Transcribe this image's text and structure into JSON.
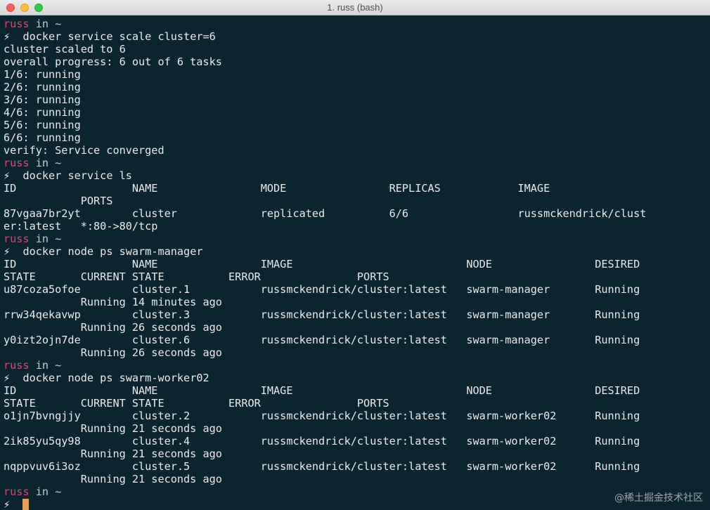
{
  "window": {
    "title": "1. russ (bash)"
  },
  "prompt": {
    "user": "russ",
    "rest": " in ~",
    "symbol": "⚡"
  },
  "lines": [
    {
      "kind": "prompt"
    },
    {
      "kind": "cmd",
      "text": "docker service scale cluster=6"
    },
    {
      "kind": "out",
      "text": "cluster scaled to 6"
    },
    {
      "kind": "out",
      "text": "overall progress: 6 out of 6 tasks"
    },
    {
      "kind": "out",
      "text": "1/6: running"
    },
    {
      "kind": "out",
      "text": "2/6: running"
    },
    {
      "kind": "out",
      "text": "3/6: running"
    },
    {
      "kind": "out",
      "text": "4/6: running"
    },
    {
      "kind": "out",
      "text": "5/6: running"
    },
    {
      "kind": "out",
      "text": "6/6: running"
    },
    {
      "kind": "out",
      "text": "verify: Service converged"
    },
    {
      "kind": "prompt"
    },
    {
      "kind": "cmd",
      "text": "docker service ls"
    },
    {
      "kind": "out",
      "text": "ID                  NAME                MODE                REPLICAS            IMAGE"
    },
    {
      "kind": "out",
      "text": "            PORTS"
    },
    {
      "kind": "out",
      "text": "87vgaa7br2yt        cluster             replicated          6/6                 russmckendrick/clust"
    },
    {
      "kind": "out",
      "text": "er:latest   *:80->80/tcp"
    },
    {
      "kind": "prompt"
    },
    {
      "kind": "cmd",
      "text": "docker node ps swarm-manager"
    },
    {
      "kind": "out",
      "text": "ID                  NAME                IMAGE                           NODE                DESIRED"
    },
    {
      "kind": "out",
      "text": "STATE       CURRENT STATE          ERROR               PORTS"
    },
    {
      "kind": "out",
      "text": "u87coza5ofoe        cluster.1           russmckendrick/cluster:latest   swarm-manager       Running"
    },
    {
      "kind": "out",
      "text": "            Running 14 minutes ago"
    },
    {
      "kind": "out",
      "text": "rrw34qekavwp        cluster.3           russmckendrick/cluster:latest   swarm-manager       Running"
    },
    {
      "kind": "out",
      "text": "            Running 26 seconds ago"
    },
    {
      "kind": "out",
      "text": "y0izt2ojn7de        cluster.6           russmckendrick/cluster:latest   swarm-manager       Running"
    },
    {
      "kind": "out",
      "text": "            Running 26 seconds ago"
    },
    {
      "kind": "prompt"
    },
    {
      "kind": "cmd",
      "text": "docker node ps swarm-worker02"
    },
    {
      "kind": "out",
      "text": "ID                  NAME                IMAGE                           NODE                DESIRED"
    },
    {
      "kind": "out",
      "text": "STATE       CURRENT STATE          ERROR               PORTS"
    },
    {
      "kind": "out",
      "text": "o1jn7bvngjjy        cluster.2           russmckendrick/cluster:latest   swarm-worker02      Running"
    },
    {
      "kind": "out",
      "text": "            Running 21 seconds ago"
    },
    {
      "kind": "out",
      "text": "2ik85yu5qy98        cluster.4           russmckendrick/cluster:latest   swarm-worker02      Running"
    },
    {
      "kind": "out",
      "text": "            Running 21 seconds ago"
    },
    {
      "kind": "out",
      "text": "nqppvuv6i3oz        cluster.5           russmckendrick/cluster:latest   swarm-worker02      Running"
    },
    {
      "kind": "out",
      "text": "            Running 21 seconds ago"
    },
    {
      "kind": "prompt"
    },
    {
      "kind": "cursor"
    }
  ],
  "watermark": "@稀土掘金技术社区",
  "colors": {
    "background": "#0b2530",
    "user": "#d94872",
    "cursor": "#e3a15a"
  }
}
